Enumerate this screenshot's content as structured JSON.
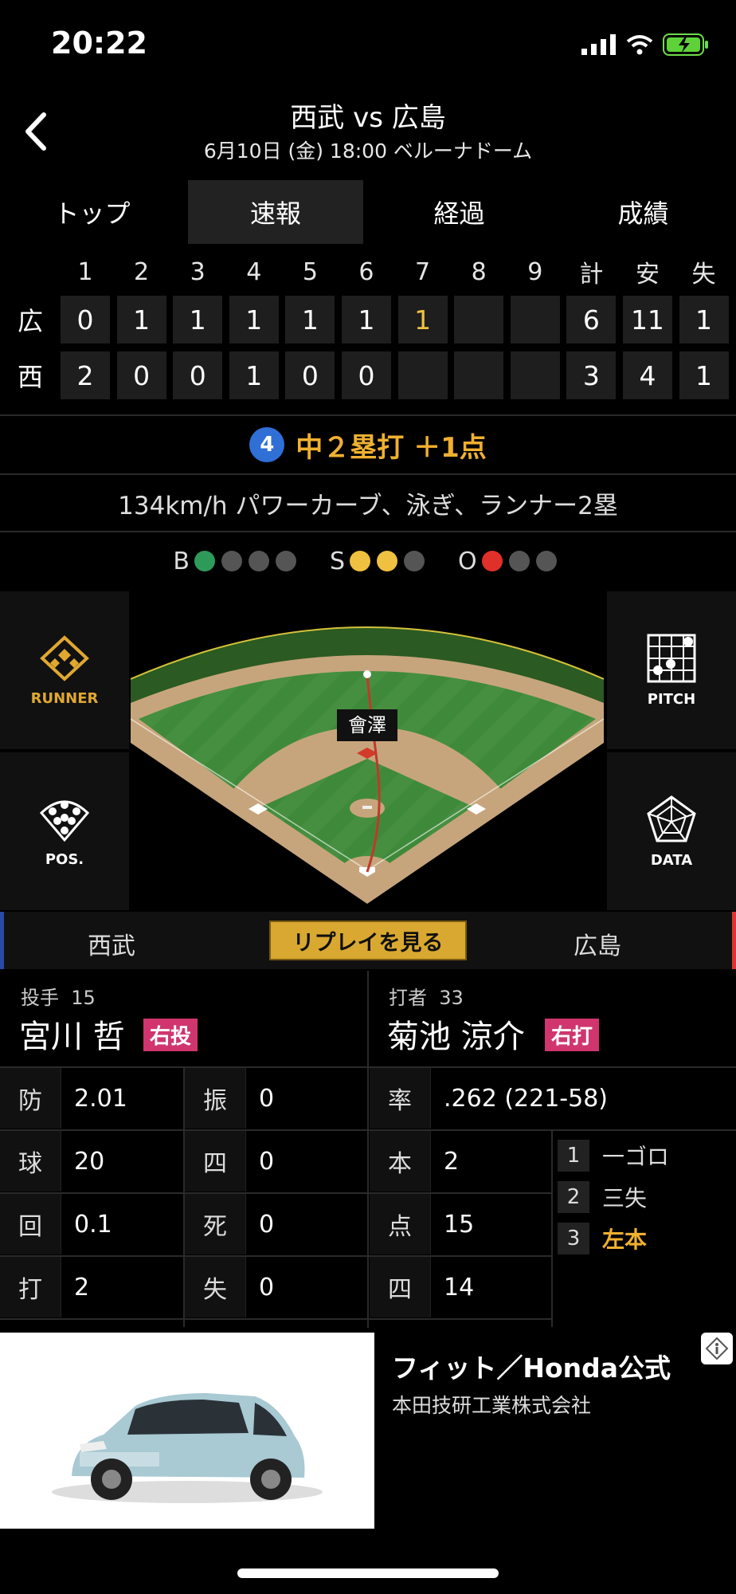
{
  "status": {
    "time": "20:22"
  },
  "header": {
    "title": "西武 vs 広島",
    "subtitle": "6月10日 (金) 18:00 ベルーナドーム"
  },
  "tabs": [
    {
      "label": "トップ",
      "active": false
    },
    {
      "label": "速報",
      "active": true
    },
    {
      "label": "経過",
      "active": false
    },
    {
      "label": "成績",
      "active": false
    }
  ],
  "scoreboard": {
    "headers": [
      "1",
      "2",
      "3",
      "4",
      "5",
      "6",
      "7",
      "8",
      "9",
      "計",
      "安",
      "失"
    ],
    "rows": [
      {
        "team": "広",
        "cells": [
          "0",
          "1",
          "1",
          "1",
          "1",
          "1",
          "1",
          "",
          "",
          "6",
          "11",
          "1"
        ],
        "highlight_index": 6
      },
      {
        "team": "西",
        "cells": [
          "2",
          "0",
          "0",
          "1",
          "0",
          "0",
          "",
          "",
          "",
          "3",
          "4",
          "1"
        ]
      }
    ]
  },
  "play": {
    "batter_order": "4",
    "result": "中２塁打 ＋1点"
  },
  "pitch_description": "134km/h パワーカーブ、泳ぎ、ランナー2塁",
  "count": {
    "b_label": "B",
    "s_label": "S",
    "o_label": "O",
    "balls": 1,
    "strikes": 2,
    "outs": 1,
    "ball_color": "#2e9a5a",
    "strike_color": "#f0c040",
    "out_color": "#e0302a"
  },
  "field": {
    "runner_label": "RUNNER",
    "pos_label": "POS.",
    "pitch_label": "PITCH",
    "data_label": "DATA",
    "fielder_name": "會澤"
  },
  "replay": {
    "left_team": "西武",
    "button": "リプレイを見る",
    "right_team": "広島"
  },
  "pitcher": {
    "role": "投手",
    "number": "15",
    "name": "宮川 哲",
    "badge": "右投"
  },
  "batter": {
    "role": "打者",
    "number": "33",
    "name": "菊池 涼介",
    "badge": "右打"
  },
  "pitcher_stats": [
    {
      "k": "防",
      "v": "2.01",
      "k2": "振",
      "v2": "0"
    },
    {
      "k": "球",
      "v": "20",
      "k2": "四",
      "v2": "0"
    },
    {
      "k": "回",
      "v": "0.1",
      "k2": "死",
      "v2": "0"
    },
    {
      "k": "打",
      "v": "2",
      "k2": "失",
      "v2": "0"
    }
  ],
  "batter_stats": [
    {
      "k": "率",
      "v": ".262 (221-58)"
    },
    {
      "k": "本",
      "v": "2"
    },
    {
      "k": "点",
      "v": "15"
    },
    {
      "k": "四",
      "v": "14"
    }
  ],
  "at_bats": [
    {
      "n": "1",
      "result": "一ゴロ",
      "highlight": false
    },
    {
      "n": "2",
      "result": "三失",
      "highlight": false
    },
    {
      "n": "3",
      "result": "左本",
      "highlight": true
    }
  ],
  "ad": {
    "headline": "フィット／Honda公式",
    "company": "本田技研工業株式会社"
  }
}
